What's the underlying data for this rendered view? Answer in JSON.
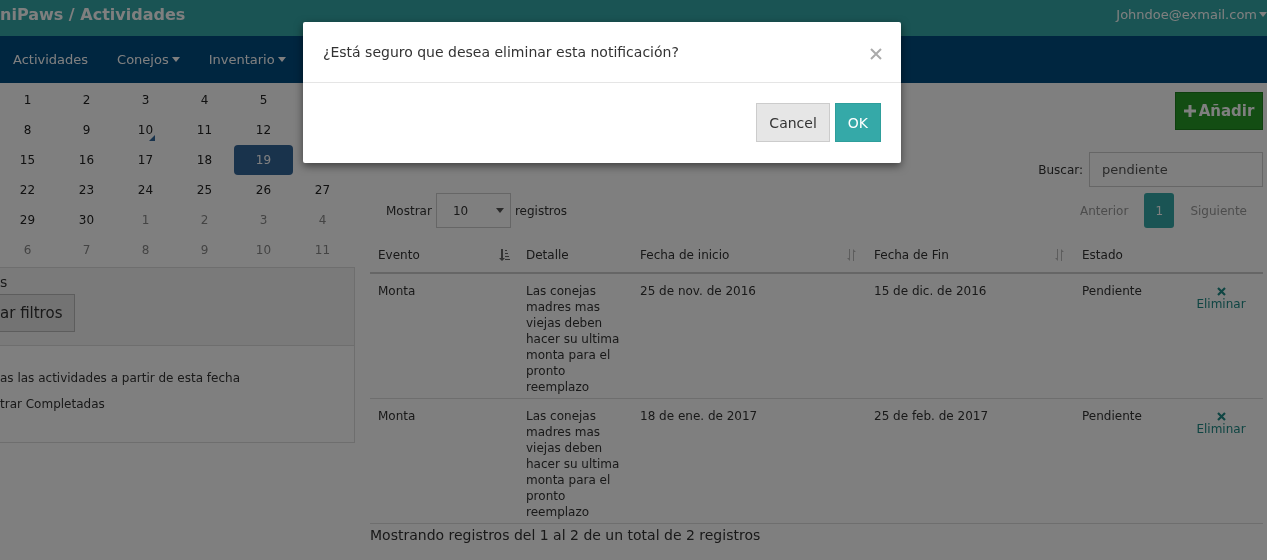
{
  "header": {
    "title": "niPaws / Actividades",
    "user": "Johndoe@exmail.com"
  },
  "nav": [
    {
      "label": "Actividades",
      "dropdown": false
    },
    {
      "label": "Conejos",
      "dropdown": true
    },
    {
      "label": "Inventario",
      "dropdown": true
    }
  ],
  "calendar": {
    "weeks": [
      [
        {
          "day": "1",
          "other_month": false,
          "selected": false,
          "has_event": false
        },
        {
          "day": "2",
          "other_month": false,
          "selected": false,
          "has_event": false
        },
        {
          "day": "3",
          "other_month": false,
          "selected": false,
          "has_event": false
        },
        {
          "day": "4",
          "other_month": false,
          "selected": false,
          "has_event": false
        },
        {
          "day": "5",
          "other_month": false,
          "selected": false,
          "has_event": false
        }
      ],
      [
        {
          "day": "8",
          "other_month": false,
          "selected": false,
          "has_event": false
        },
        {
          "day": "9",
          "other_month": false,
          "selected": false,
          "has_event": false
        },
        {
          "day": "10",
          "other_month": false,
          "selected": false,
          "has_event": true
        },
        {
          "day": "11",
          "other_month": false,
          "selected": false,
          "has_event": false
        },
        {
          "day": "12",
          "other_month": false,
          "selected": false,
          "has_event": false
        }
      ],
      [
        {
          "day": "15",
          "other_month": false,
          "selected": false,
          "has_event": false
        },
        {
          "day": "16",
          "other_month": false,
          "selected": false,
          "has_event": false
        },
        {
          "day": "17",
          "other_month": false,
          "selected": false,
          "has_event": false
        },
        {
          "day": "18",
          "other_month": false,
          "selected": false,
          "has_event": false
        },
        {
          "day": "19",
          "other_month": false,
          "selected": true,
          "has_event": false
        }
      ],
      [
        {
          "day": "22",
          "other_month": false,
          "selected": false,
          "has_event": false
        },
        {
          "day": "23",
          "other_month": false,
          "selected": false,
          "has_event": false
        },
        {
          "day": "24",
          "other_month": false,
          "selected": false,
          "has_event": false
        },
        {
          "day": "25",
          "other_month": false,
          "selected": false,
          "has_event": false
        },
        {
          "day": "26",
          "other_month": false,
          "selected": false,
          "has_event": false
        },
        {
          "day": "27",
          "other_month": false,
          "selected": false,
          "has_event": false
        }
      ],
      [
        {
          "day": "29",
          "other_month": false,
          "selected": false,
          "has_event": false
        },
        {
          "day": "30",
          "other_month": false,
          "selected": false,
          "has_event": false
        },
        {
          "day": "1",
          "other_month": true,
          "selected": false,
          "has_event": false
        },
        {
          "day": "2",
          "other_month": true,
          "selected": false,
          "has_event": false
        },
        {
          "day": "3",
          "other_month": true,
          "selected": false,
          "has_event": false
        },
        {
          "day": "4",
          "other_month": true,
          "selected": false,
          "has_event": false
        }
      ],
      [
        {
          "day": "6",
          "other_month": true,
          "selected": false,
          "has_event": false
        },
        {
          "day": "7",
          "other_month": true,
          "selected": false,
          "has_event": false
        },
        {
          "day": "8",
          "other_month": true,
          "selected": false,
          "has_event": false
        },
        {
          "day": "9",
          "other_month": true,
          "selected": false,
          "has_event": false
        },
        {
          "day": "10",
          "other_month": true,
          "selected": false,
          "has_event": false
        },
        {
          "day": "11",
          "other_month": true,
          "selected": false,
          "has_event": false
        }
      ]
    ]
  },
  "filters": {
    "title": "s",
    "button": "ar filtros",
    "options": [
      "as las actividades a partir de esta fecha",
      "trar Completadas"
    ]
  },
  "add_button": "Añadir",
  "search": {
    "label": "Buscar:",
    "value": "pendiente"
  },
  "length": {
    "before": "Mostrar",
    "value": "10",
    "after": "registros"
  },
  "pagination": {
    "previous": "Anterior",
    "pages": [
      {
        "label": "1",
        "selected": true
      }
    ],
    "next": "Siguiente"
  },
  "table": {
    "columns": [
      {
        "label": "Evento",
        "sortable": true,
        "sorted": true
      },
      {
        "label": "Detalle",
        "sortable": false
      },
      {
        "label": "Fecha de inicio",
        "sortable": true,
        "sorted": false
      },
      {
        "label": "Fecha de Fin",
        "sortable": true,
        "sorted": false
      },
      {
        "label": "Estado",
        "sortable": false
      }
    ],
    "rows": [
      {
        "cells": [
          "Monta",
          "Las conejas madres mas viejas deben hacer su ultima monta para el pronto reemplazo",
          "25 de nov. de 2016",
          "15 de dic. de 2016",
          "Pendiente"
        ],
        "action": "Eliminar"
      },
      {
        "cells": [
          "Monta",
          "Las conejas madres mas viejas deben hacer su ultima monta para el pronto reemplazo",
          "18 de ene. de 2017",
          "25 de feb. de 2017",
          "Pendiente"
        ],
        "action": "Eliminar"
      }
    ]
  },
  "info": "Mostrando registros del 1 al 2 de un total de 2 registros",
  "dialog": {
    "message": "¿Está seguro que desea eliminar esta notificación?",
    "cancel": "Cancel",
    "ok": "OK"
  }
}
